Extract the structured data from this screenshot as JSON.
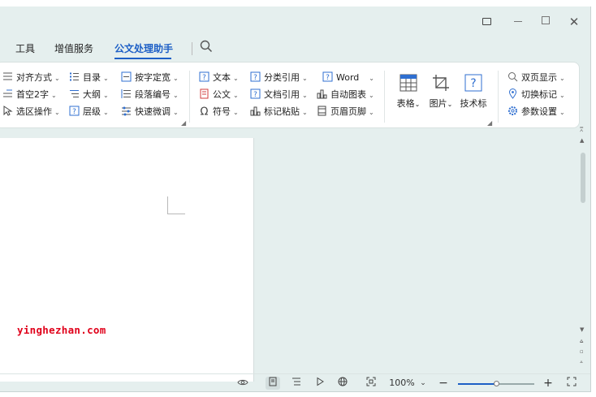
{
  "window": {
    "controls": [
      "restore-icon",
      "minimize-icon",
      "maximize-icon",
      "close-icon"
    ],
    "close_glyph": "✕"
  },
  "tabs": [
    {
      "label": "工具"
    },
    {
      "label": "增值服务"
    },
    {
      "label": "公文处理助手",
      "active": true
    }
  ],
  "accent_color": "#1d5fc6",
  "ribbon": {
    "group1": {
      "align": "对齐方式",
      "first_indent": "首空2字",
      "select_op": "选区操作"
    },
    "group2": {
      "toc": "目录",
      "outline": "大纲",
      "level": "层级"
    },
    "group3": {
      "char_width": "按字定宽",
      "para_number": "段落编号",
      "quick_adjust": "快速微调"
    },
    "group4": {
      "text": "文本",
      "official": "公文",
      "symbol": "符号"
    },
    "group5": {
      "class_ref": "分类引用",
      "doc_ref": "文档引用",
      "mark_paste": "标记粘贴"
    },
    "group6": {
      "word": "Word",
      "auto_chart": "自动图表",
      "header_footer": "页眉页脚"
    },
    "group7": {
      "table": "表格",
      "image": "图片",
      "tech_mark": "技术标"
    },
    "group8": {
      "double_page": "双页显示",
      "toggle_mark": "切换标记",
      "param_settings": "参数设置"
    }
  },
  "document": {
    "watermark": "yinghezhan.com"
  },
  "statusbar": {
    "zoom": "100%",
    "zoom_fraction": 0.5,
    "minus": "−",
    "plus": "+"
  }
}
